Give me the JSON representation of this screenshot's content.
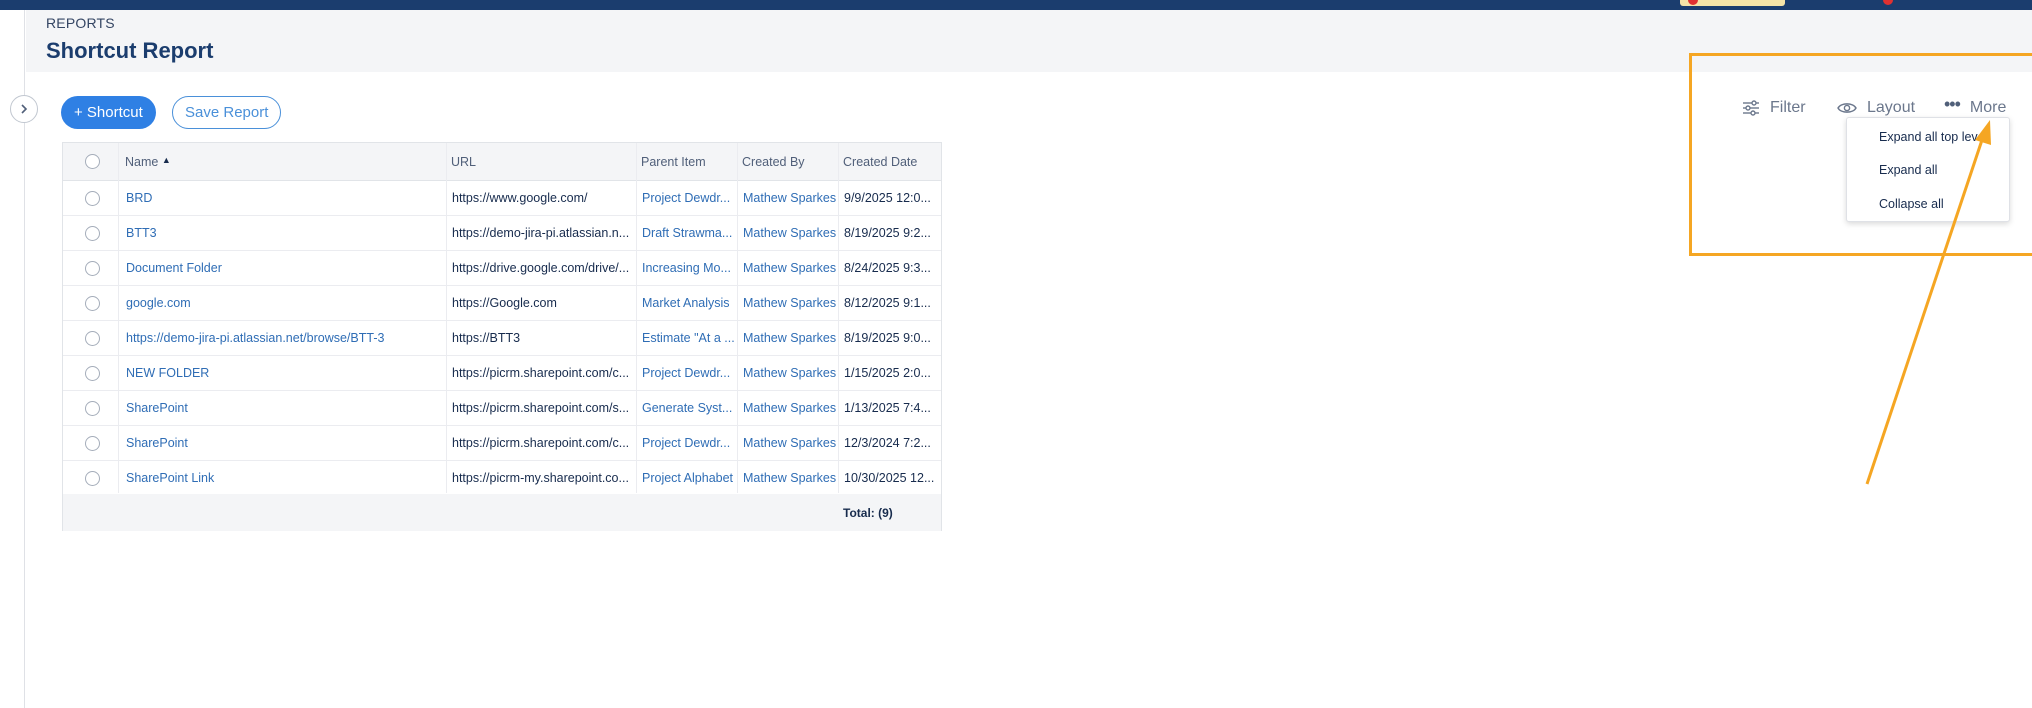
{
  "breadcrumb": "REPORTS",
  "page_title": "Shortcut Report",
  "buttons": {
    "add_shortcut": "+ Shortcut",
    "save_report": "Save Report"
  },
  "toolbar": {
    "filter": "Filter",
    "layout": "Layout",
    "more": "More"
  },
  "more_menu": {
    "items": [
      "Expand all top level",
      "Expand all",
      "Collapse all"
    ]
  },
  "table": {
    "columns": [
      "Name",
      "URL",
      "Parent Item",
      "Created By",
      "Created Date"
    ],
    "sort_indicator": "▲",
    "rows": [
      {
        "name": "BRD",
        "url": "https://www.google.com/",
        "parent": "Project Dewdr...",
        "created_by": "Mathew Sparkes",
        "created_date": "9/9/2025 12:0..."
      },
      {
        "name": "BTT3",
        "url": "https://demo-jira-pi.atlassian.n...",
        "parent": "Draft Strawma...",
        "created_by": "Mathew Sparkes",
        "created_date": "8/19/2025 9:2..."
      },
      {
        "name": "Document Folder",
        "url": "https://drive.google.com/drive/...",
        "parent": "Increasing Mo...",
        "created_by": "Mathew Sparkes",
        "created_date": "8/24/2025 9:3..."
      },
      {
        "name": "google.com",
        "url": "https://Google.com",
        "parent": "Market Analysis",
        "created_by": "Mathew Sparkes",
        "created_date": "8/12/2025 9:1..."
      },
      {
        "name": "https://demo-jira-pi.atlassian.net/browse/BTT-3",
        "url": "https://BTT3",
        "parent": "Estimate \"At a ...",
        "created_by": "Mathew Sparkes",
        "created_date": "8/19/2025 9:0..."
      },
      {
        "name": "NEW FOLDER",
        "url": "https://picrm.sharepoint.com/c...",
        "parent": "Project Dewdr...",
        "created_by": "Mathew Sparkes",
        "created_date": "1/15/2025 2:0..."
      },
      {
        "name": "SharePoint",
        "url": "https://picrm.sharepoint.com/s...",
        "parent": "Generate Syst...",
        "created_by": "Mathew Sparkes",
        "created_date": "1/13/2025 7:4..."
      },
      {
        "name": "SharePoint",
        "url": "https://picrm.sharepoint.com/c...",
        "parent": "Project Dewdr...",
        "created_by": "Mathew Sparkes",
        "created_date": "12/3/2024 7:2..."
      },
      {
        "name": "SharePoint Link",
        "url": "https://picrm-my.sharepoint.co...",
        "parent": "Project Alphabet",
        "created_by": "Mathew Sparkes",
        "created_date": "10/30/2025 12..."
      }
    ],
    "total": "Total: (9)"
  },
  "colors": {
    "primary": "#2f80e4",
    "highlight": "#f5a623",
    "header_dark": "#1b3d6e",
    "link": "#2f6db5"
  }
}
